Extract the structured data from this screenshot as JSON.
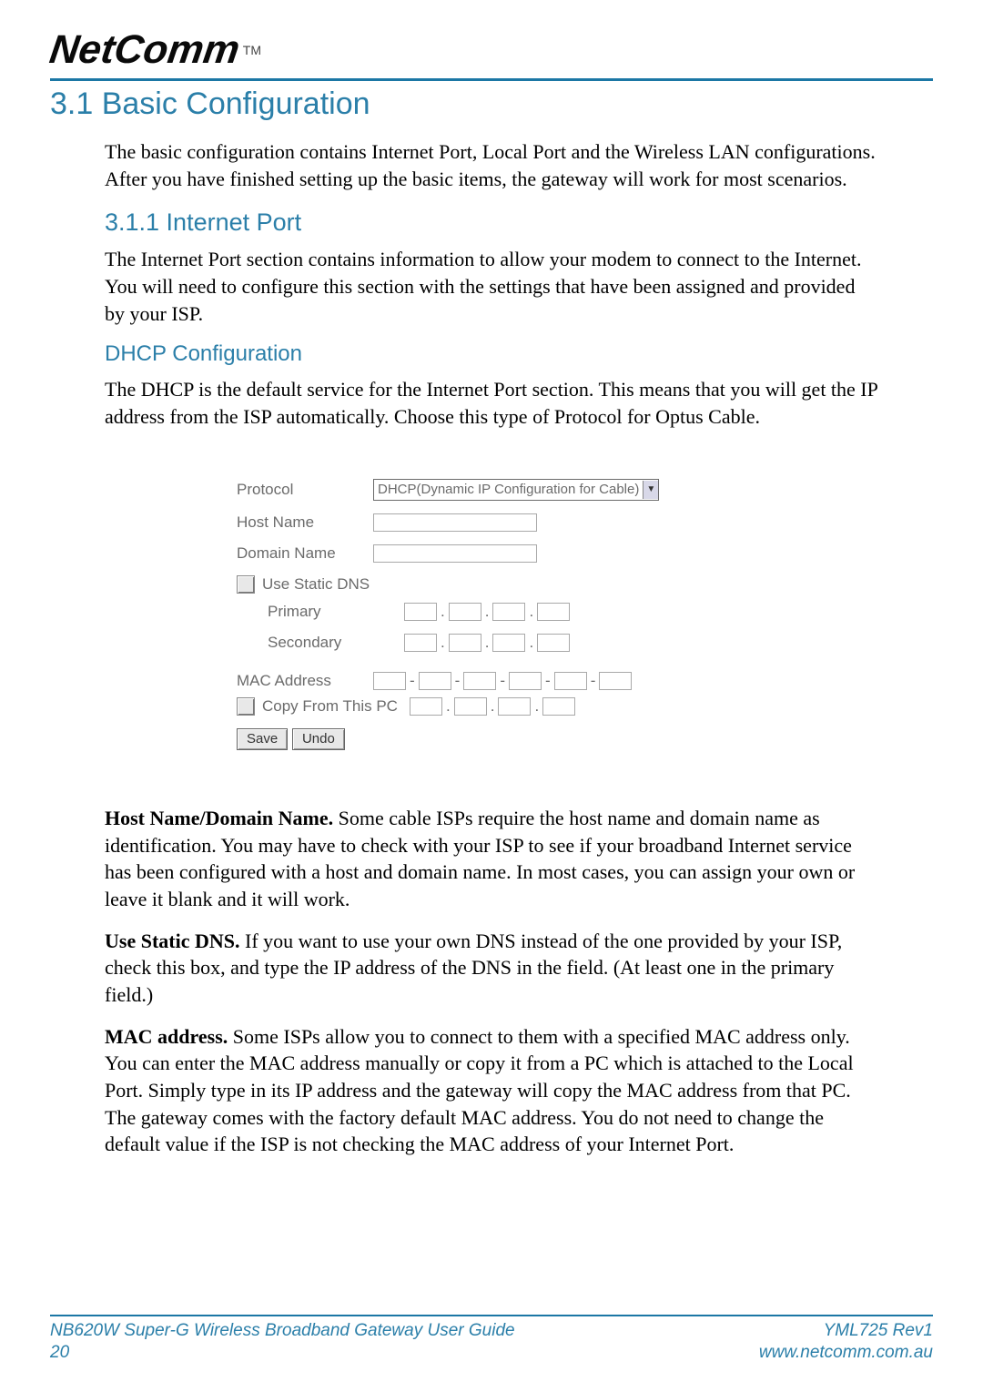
{
  "brand": "NetComm",
  "tm": "TM",
  "headings": {
    "h1": "3.1 Basic Configuration",
    "h2": "3.1.1 Internet Port",
    "h3": "DHCP Configuration"
  },
  "paragraphs": {
    "p1": "The basic configuration contains Internet Port, Local Port and the Wireless LAN configurations. After you have finished setting up the basic items, the gateway will work for most scenarios.",
    "p2": "The Internet Port section contains information to allow your modem to connect to the Internet. You will need to configure this section with the settings that have been assigned and provided by your ISP.",
    "p3": "The DHCP is the default service for the Internet Port section.  This means that you will get the IP address from the ISP automatically.  Choose this type of Protocol for Optus Cable.",
    "hostname_bold": "Host Name/Domain Name.",
    "hostname_text": " Some cable ISPs require the host name and domain name as identification.  You may have to check with your ISP to see if your broadband Internet service has been configured with a host and domain name. In most cases, you can assign your own or leave it blank and it will work.",
    "usedns_bold": "Use Static DNS.",
    "usedns_text": " If you want to use your own DNS instead of the one provided by your ISP, check this box, and type the IP address of the DNS in the field. (At least one in the primary field.)",
    "mac_bold": "MAC address.",
    "mac_text": " Some ISPs allow you to connect to them with a specified MAC address only. You can enter the MAC address manually or copy it from a PC which is attached to the Local Port.  Simply type in its IP address and the gateway will copy the MAC address from that PC. The gateway comes with the factory default MAC address.  You do not need to change the default value if the ISP is not checking the MAC address of your Internet Port."
  },
  "form": {
    "protocol_label": "Protocol",
    "protocol_value": "DHCP(Dynamic IP Configuration for Cable)",
    "hostname_label": "Host Name",
    "domain_label": "Domain Name",
    "usedns_label": "Use Static DNS",
    "primary_label": "Primary",
    "secondary_label": "Secondary",
    "mac_label": "MAC Address",
    "copy_label": "Copy From This PC",
    "save": "Save",
    "undo": "Undo"
  },
  "footer": {
    "left_title": "NB620W Super-G Wireless Broadband  Gateway User Guide",
    "left_page": "20",
    "right_rev": "YML725 Rev1",
    "right_url": "www.netcomm.com.au"
  }
}
